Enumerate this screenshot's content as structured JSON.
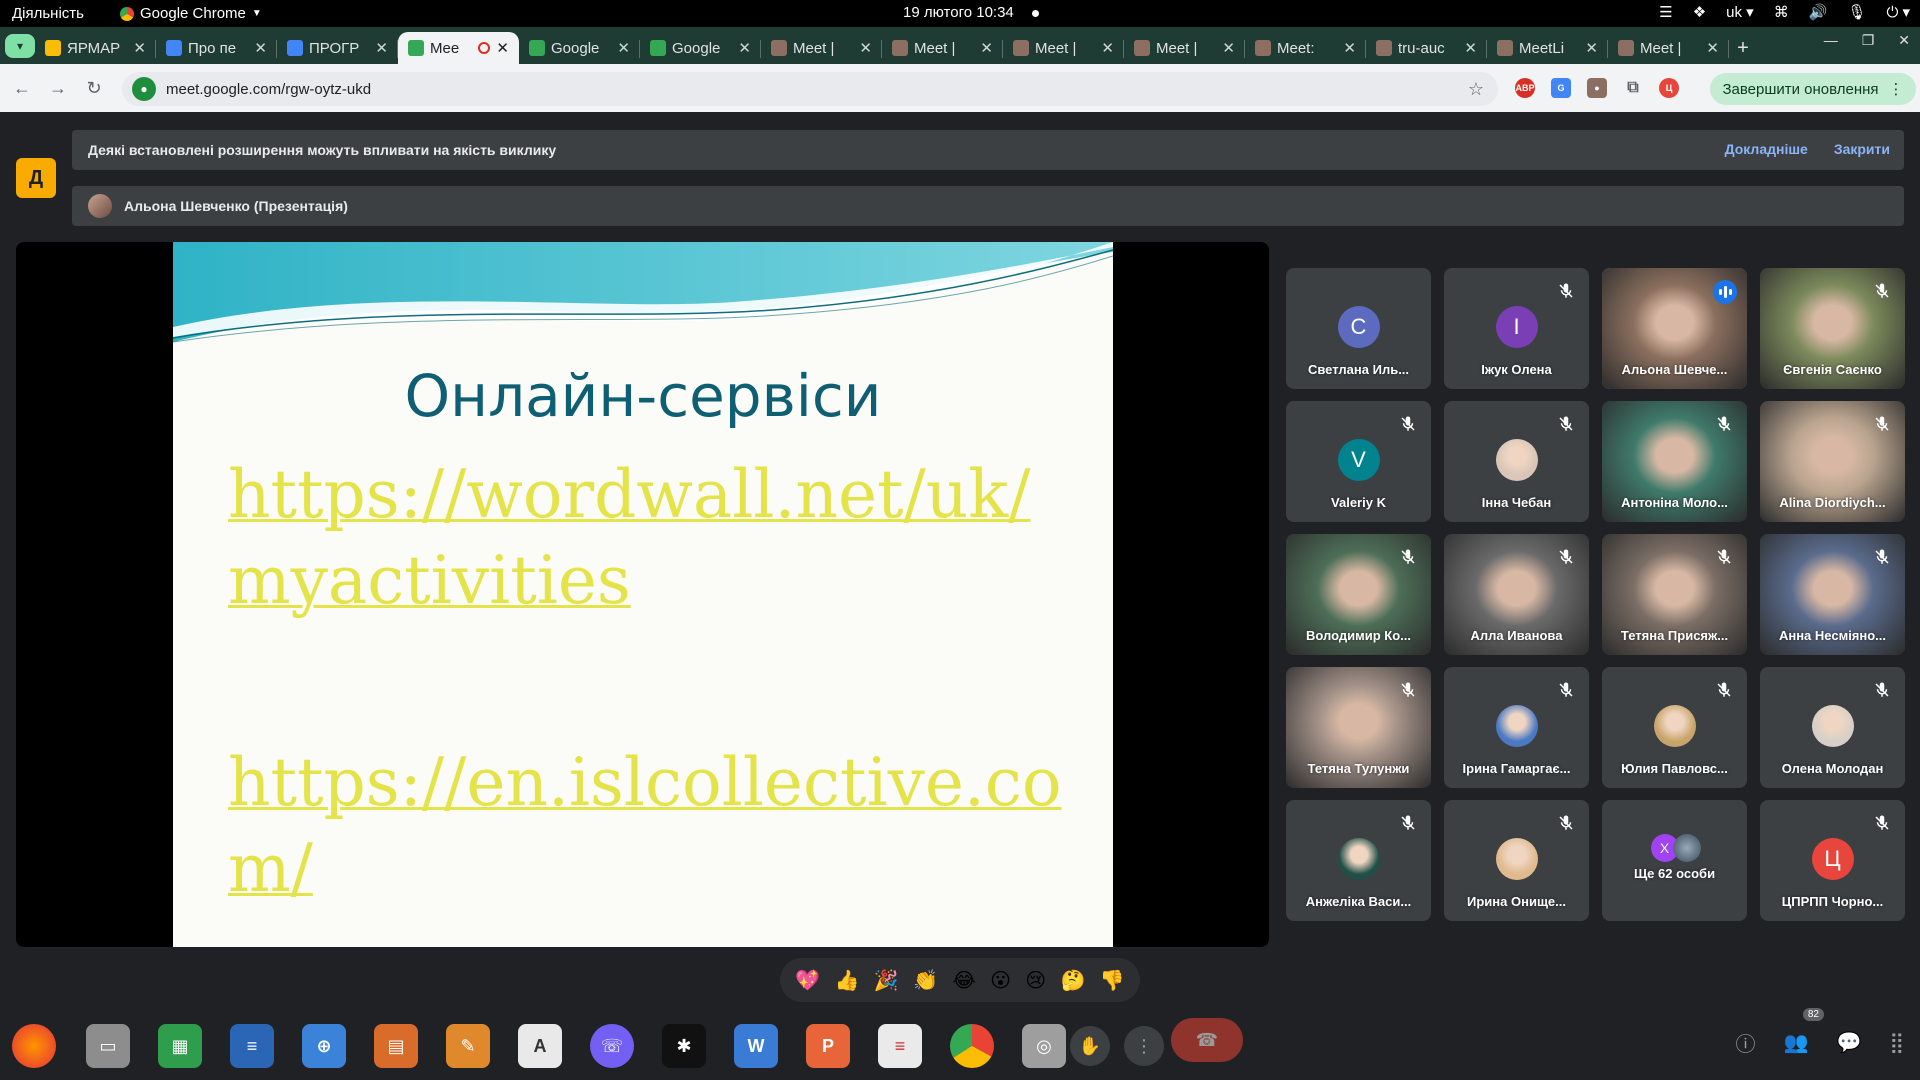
{
  "gnome": {
    "activities": "Діяльність",
    "app_name": "Google Chrome",
    "clock": "19 лютого  10:34",
    "lang": "uk"
  },
  "tabs": [
    {
      "label": "ЯРМАР",
      "color": "#fbbc04",
      "icon": "drive-icon"
    },
    {
      "label": "Про пе",
      "color": "#4285f4",
      "icon": "docs-icon"
    },
    {
      "label": "ПРОГР",
      "color": "#4285f4",
      "icon": "docs-icon"
    },
    {
      "label": "Mee",
      "color": "#34a853",
      "icon": "meet-icon",
      "active": true
    },
    {
      "label": "Google",
      "color": "#34a853",
      "icon": "meet-icon"
    },
    {
      "label": "Google",
      "color": "#34a853",
      "icon": "meet-icon"
    },
    {
      "label": "Meet |",
      "color": "#8d6e63",
      "icon": "ext-icon"
    },
    {
      "label": "Meet |",
      "color": "#8d6e63",
      "icon": "ext-icon"
    },
    {
      "label": "Meet |",
      "color": "#8d6e63",
      "icon": "ext-icon"
    },
    {
      "label": "Meet |",
      "color": "#8d6e63",
      "icon": "ext-icon"
    },
    {
      "label": "Meet: ",
      "color": "#8d6e63",
      "icon": "ext-icon"
    },
    {
      "label": "tru-auc",
      "color": "#8d6e63",
      "icon": "ext-icon"
    },
    {
      "label": "MeetLi",
      "color": "#8d6e63",
      "icon": "ext-icon"
    },
    {
      "label": "Meet |",
      "color": "#8d6e63",
      "icon": "ext-icon"
    }
  ],
  "browser": {
    "url": "meet.google.com/rgw-oytz-ukd",
    "update_label": "Завершити оновлення"
  },
  "meet": {
    "warning": "Деякі встановлені розширення можуть впливати на якість виклику",
    "learn_more": "Докладніше",
    "close": "Закрити",
    "presenter": "Альона Шевченко (Презентація)"
  },
  "slide": {
    "title": "Онлайн-сервіси",
    "link1": "https://wordwall.net/uk/myactivities",
    "link2": "https://en.islcollective.com/"
  },
  "participants": [
    {
      "name": "Светлана Иль...",
      "type": "letter",
      "letter": "C",
      "color": "#5c6bc0",
      "muted": false
    },
    {
      "name": "Іжук Олена",
      "type": "letter",
      "letter": "I",
      "color": "#7b3fb5",
      "muted": true
    },
    {
      "name": "Альона Шевче...",
      "type": "photo",
      "color": "#8b6f5e",
      "speaking": true
    },
    {
      "name": "Євгенія Саєнко",
      "type": "photo",
      "color": "#7c8a5c",
      "muted": true
    },
    {
      "name": "Valeriy K",
      "type": "letter",
      "letter": "V",
      "color": "#00838f",
      "muted": true
    },
    {
      "name": "Інна Чебан",
      "type": "avatar",
      "color": "#d9c6b8",
      "muted": true
    },
    {
      "name": "Антоніна Моло...",
      "type": "photo",
      "color": "#3f7a6a",
      "muted": true
    },
    {
      "name": "Alina Diordiych...",
      "type": "photo",
      "color": "#b9a48f",
      "muted": true
    },
    {
      "name": "Володимир Ко...",
      "type": "photo",
      "color": "#4d6e57",
      "muted": true
    },
    {
      "name": "Алла Иванова",
      "type": "photo",
      "color": "#6a6a6a",
      "muted": true
    },
    {
      "name": "Тетяна Присяж...",
      "type": "photo",
      "color": "#7b6e65",
      "muted": true
    },
    {
      "name": "Анна Несміяно...",
      "type": "photo",
      "color": "#5a6b8c",
      "muted": true
    },
    {
      "name": "Тетяна Тулунжи",
      "type": "photo",
      "color": "#a08f86",
      "muted": true
    },
    {
      "name": "Ірина Гамаргає...",
      "type": "avatar",
      "color": "#4b79c4",
      "muted": true
    },
    {
      "name": "Юлия Павловс...",
      "type": "avatar",
      "color": "#c8a46a",
      "muted": true
    },
    {
      "name": "Олена Молодан",
      "type": "avatar",
      "color": "#d7cfc8",
      "muted": true
    },
    {
      "name": "Анжеліка Васи...",
      "type": "avatar",
      "color": "#1f4f47",
      "muted": true
    },
    {
      "name": "Ирина Онище...",
      "type": "avatar",
      "color": "#e0b98c",
      "muted": true
    },
    {
      "name": "Ще 62 особи",
      "type": "more",
      "letter": "Х",
      "color": "#a142f4"
    },
    {
      "name": "ЦПРПП Чорно...",
      "type": "letter",
      "letter": "Ц",
      "color": "#e8453c",
      "muted": true
    }
  ],
  "reactions": [
    "💖",
    "👍",
    "🎉",
    "👏",
    "😂",
    "😮",
    "😢",
    "🤔",
    "👎"
  ],
  "participant_badge": "82",
  "dock_letter": "Ц"
}
